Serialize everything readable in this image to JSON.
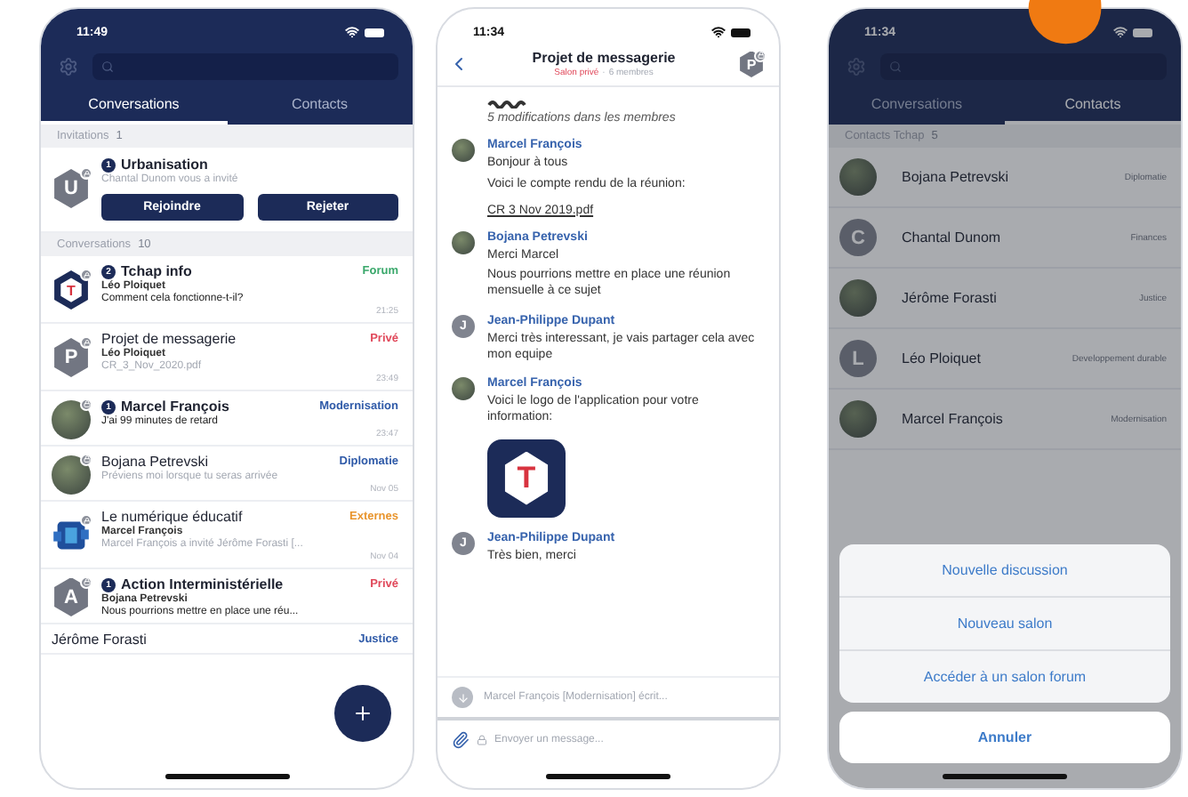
{
  "conversations_screen": {
    "status_time": "11:49",
    "tabs": [
      {
        "label": "Conversations",
        "selected": true
      },
      {
        "label": "Contacts",
        "selected": false
      }
    ],
    "invitations": {
      "title": "Invitations",
      "count": "1",
      "items": [
        {
          "badge": "1",
          "name": "Urbanisation",
          "subtitle": "Chantal Dunom vous a invité",
          "avatar": {
            "kind": "hexagon",
            "letter": "U",
            "locked": true
          },
          "buttons": [
            "Rejoindre",
            "Rejeter"
          ]
        }
      ]
    },
    "conversations": {
      "title": "Conversations",
      "count": "10",
      "items": [
        {
          "badge": "2",
          "name": "Tchap info",
          "tag": "Forum",
          "color": "#3aa86b",
          "sender": "Léo Ploiquet",
          "preview": "Comment cela fonctionne-t-il?",
          "time": "21:25",
          "unread": true,
          "avatar": {
            "kind": "logo",
            "letter": "T",
            "locked": true
          }
        },
        {
          "name": "Projet de messagerie",
          "tag": "Privé",
          "color": "#e0485a",
          "sender": "Léo Ploiquet",
          "preview": "CR_3_Nov_2020.pdf",
          "time": "23:49",
          "unread": false,
          "avatar": {
            "kind": "hexagon",
            "letter": "P",
            "locked": true
          }
        },
        {
          "badge": "1",
          "name": "Marcel François",
          "tag": "Modernisation",
          "color": "#2f5aa8",
          "preview": "J'ai 99 minutes de retard",
          "time": "23:47",
          "unread": true,
          "avatar": {
            "kind": "photo",
            "locked": true
          }
        },
        {
          "name": "Bojana Petrevski",
          "tag": "Diplomatie",
          "color": "#2f5aa8",
          "preview": "Préviens moi lorsque tu seras arrivée",
          "time": "Nov 05",
          "unread": false,
          "avatar": {
            "kind": "photo",
            "locked": true
          }
        },
        {
          "name": "Le numérique éducatif",
          "tag": "Externes",
          "color": "#e8942c",
          "sender": "Marcel François",
          "preview": "Marcel François a invité Jérôme Forasti [...",
          "time": "Nov 04",
          "unread": false,
          "avatar": {
            "kind": "emblem",
            "locked": true
          }
        },
        {
          "badge": "1",
          "name": "Action Interministérielle",
          "tag": "Privé",
          "color": "#e0485a",
          "sender": "Bojana Petrevski",
          "preview": "Nous pourrions mettre en place une réu...",
          "unread": true,
          "avatar": {
            "kind": "hexagon",
            "letter": "A",
            "locked": true
          }
        },
        {
          "name": "Jérôme Forasti",
          "tag": "Justice",
          "color": "#2f5aa8",
          "unread": false,
          "avatar": {
            "kind": "none"
          }
        }
      ]
    }
  },
  "chat_screen": {
    "status_time": "11:34",
    "title": "Projet de messagerie",
    "room_type": "Salon privé",
    "separator": "·",
    "members": "6 membres",
    "avatar": {
      "kind": "hexagon",
      "letter": "P",
      "locked": true
    },
    "timeline": [
      {
        "kind": "membership",
        "text": "5 modifications dans les membres"
      },
      {
        "kind": "message",
        "sender": "Marcel François",
        "avatar": {
          "kind": "photo"
        },
        "lines": [
          "Bonjour à tous",
          "Voici le compte rendu de la réunion:"
        ],
        "attachment": "CR 3 Nov 2019.pdf"
      },
      {
        "kind": "message",
        "sender": "Bojana Petrevski",
        "avatar": {
          "kind": "photo"
        },
        "lines": [
          "Merci Marcel",
          "Nous pourrions mettre en place une réunion mensuelle à ce sujet"
        ]
      },
      {
        "kind": "message",
        "sender": "Jean-Philippe Dupant",
        "avatar": {
          "kind": "letter",
          "letter": "J"
        },
        "lines": [
          "Merci très interessant, je vais partager cela avec mon equipe"
        ]
      },
      {
        "kind": "message",
        "sender": "Marcel François",
        "avatar": {
          "kind": "photo"
        },
        "lines": [
          "Voici le logo de l'application pour votre information:"
        ],
        "image_letter": "T"
      },
      {
        "kind": "message",
        "sender": "Jean-Philippe Dupant",
        "avatar": {
          "kind": "letter",
          "letter": "J"
        },
        "lines": [
          "Très bien, merci"
        ]
      }
    ],
    "typing": "Marcel François [Modernisation] écrit...",
    "composer": {
      "placeholder": "Envoyer un message..."
    }
  },
  "contacts_screen": {
    "status_time": "11:34",
    "tabs": [
      {
        "label": "Conversations",
        "selected": false
      },
      {
        "label": "Contacts",
        "selected": true
      }
    ],
    "section": {
      "title": "Contacts Tchap",
      "count": "5"
    },
    "contacts": [
      {
        "name": "Bojana Petrevski",
        "tag": "Diplomatie",
        "avatar": {
          "kind": "photo"
        }
      },
      {
        "name": "Chantal Dunom",
        "tag": "Finances",
        "avatar": {
          "kind": "letter",
          "letter": "C"
        }
      },
      {
        "name": "Jérôme Forasti",
        "tag": "Justice",
        "avatar": {
          "kind": "photo"
        }
      },
      {
        "name": "Léo Ploiquet",
        "tag": "Developpement durable",
        "avatar": {
          "kind": "letter",
          "letter": "L"
        }
      },
      {
        "name": "Marcel François",
        "tag": "Modernisation",
        "avatar": {
          "kind": "photo"
        }
      }
    ],
    "action_sheet": {
      "options": [
        "Nouvelle discussion",
        "Nouveau salon",
        "Accéder à un salon forum"
      ],
      "cancel": "Annuler"
    }
  }
}
